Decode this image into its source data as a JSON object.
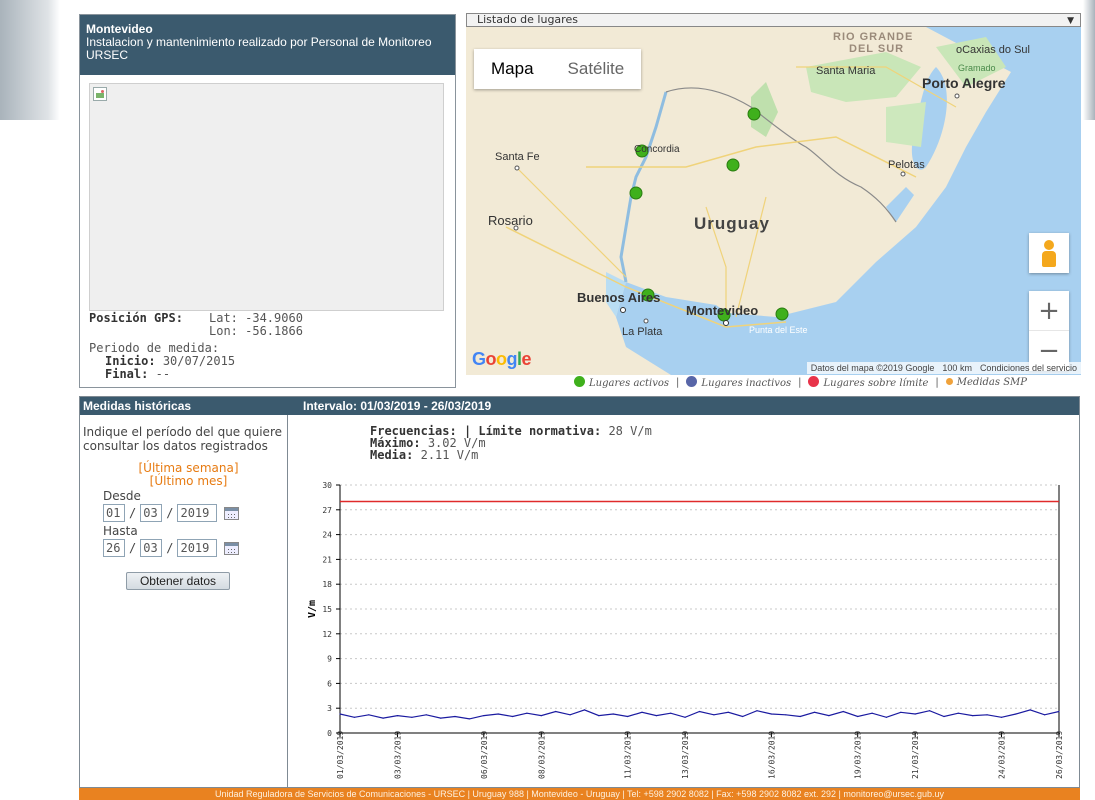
{
  "station": {
    "name": "Montevideo",
    "description": "Instalacion y mantenimiento realizado por Personal de Monitoreo URSEC",
    "gps_label": "Posición GPS:",
    "lat": "Lat: -34.9060",
    "lon": "Lon: -56.1866",
    "period_label": "Periodo de medida:",
    "start_label": "Inicio:",
    "start_value": "30/07/2015",
    "end_label": "Final:",
    "end_value": "--"
  },
  "map": {
    "select_label": "Listado de lugares",
    "type_map": "Mapa",
    "type_satellite": "Satélite",
    "zoom_in": "+",
    "zoom_out": "−",
    "google": "Google",
    "attribution": "Datos del mapa ©2019 Google",
    "scale": "100 km",
    "terms": "Condiciones del servicio",
    "labels": {
      "rio_grande": "RIO GRANDE",
      "del_sur": "DEL SUR",
      "caxias": "oCaxias do Sul",
      "santa_maria": "Santa Maria",
      "gramado": "Gramado",
      "porto_alegre": "Porto Alegre",
      "santa_fe": "Santa Fe",
      "concordia": "Concordia",
      "pelotas": "Pelotas",
      "rosario": "Rosario",
      "uruguay": "Uruguay",
      "buenos_aires": "Buenos Aires",
      "montevideo": "Montevideo",
      "la_plata": "La Plata",
      "punta_del_este": "Punta del Este"
    }
  },
  "legend": {
    "active": "Lugares activos",
    "inactive": "Lugares inactivos",
    "over_limit": "Lugares sobre límite",
    "smp": "Medidas SMP",
    "separator": "|",
    "colors": {
      "active": "#3fb01c",
      "inactive": "#5866a8",
      "over_limit": "#e8334a",
      "smp": "#f0a23b"
    }
  },
  "history": {
    "title": "Medidas históricas",
    "interval": "Intervalo: 01/03/2019 - 26/03/2019",
    "intro": "Indique el período del que quiere consultar los datos registrados",
    "last_week": "[Última semana]",
    "last_month": "[Último mes]",
    "from_label": "Desde",
    "from_day": "01",
    "from_month": "03",
    "from_year": "2019",
    "to_label": "Hasta",
    "to_day": "26",
    "to_month": "03",
    "to_year": "2019",
    "slash": "/",
    "button": "Obtener datos",
    "freq_label": "Frecuencias:",
    "limit_label": "| Límite normativa:",
    "limit_value": "28 V/m",
    "max_label": "Máximo:",
    "max_value": "3.02 V/m",
    "avg_label": "Media:",
    "avg_value": "2.11 V/m"
  },
  "chart_data": {
    "type": "line",
    "ylabel": "V/m",
    "ylim": [
      0,
      30
    ],
    "yticks": [
      0,
      3,
      6,
      9,
      12,
      15,
      18,
      21,
      24,
      27,
      30
    ],
    "grid": true,
    "xticks": [
      "01/03/2019",
      "03/03/2019",
      "06/03/2019",
      "08/03/2019",
      "11/03/2019",
      "13/03/2019",
      "16/03/2019",
      "19/03/2019",
      "21/03/2019",
      "24/03/2019",
      "26/03/2019"
    ],
    "limit_line": {
      "value": 28,
      "color": "#e02a2a"
    },
    "series": [
      {
        "color": "#1a1aa0",
        "x_days": [
          0,
          0.5,
          1,
          1.5,
          2,
          2.5,
          3,
          3.5,
          4,
          4.5,
          5,
          5.5,
          6,
          6.5,
          7,
          7.5,
          8,
          8.5,
          9,
          9.5,
          10,
          10.5,
          11,
          11.5,
          12,
          12.5,
          13,
          13.5,
          14,
          14.5,
          15,
          15.5,
          16,
          16.5,
          17,
          17.5,
          18,
          18.5,
          19,
          19.5,
          20,
          20.5,
          21,
          21.5,
          22,
          22.5,
          23,
          23.5,
          24,
          24.5,
          25
        ],
        "values": [
          2.3,
          1.9,
          2.2,
          1.8,
          2.1,
          1.9,
          2.2,
          1.8,
          2.0,
          1.7,
          2.1,
          2.3,
          2.0,
          2.4,
          2.1,
          2.6,
          2.2,
          2.8,
          2.1,
          2.3,
          2.0,
          2.5,
          2.1,
          2.4,
          1.9,
          2.6,
          2.2,
          2.5,
          2.0,
          2.7,
          2.3,
          2.2,
          2.0,
          2.5,
          2.1,
          2.6,
          2.0,
          2.4,
          1.9,
          2.5,
          2.3,
          2.7,
          2.0,
          2.4,
          2.1,
          2.2,
          1.9,
          2.3,
          2.8,
          2.2,
          2.6
        ]
      }
    ]
  },
  "footer": {
    "text": "Unidad Reguladora de Servicios de Comunicaciones - URSEC | Uruguay 988 | Montevideo - Uruguay | Tel: +598 2902 8082 | Fax: +598 2902 8082 ext. 292 | monitoreo@ursec.gub.uy"
  }
}
